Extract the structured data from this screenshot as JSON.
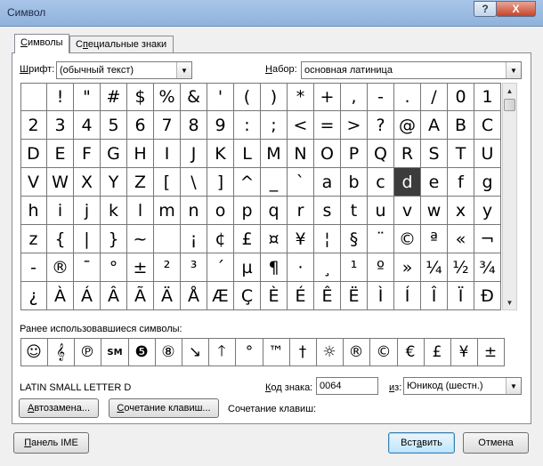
{
  "window": {
    "title": "Символ",
    "help_label": "?",
    "close_label": "X"
  },
  "tabs": [
    {
      "label": "Символы",
      "hotkey": "С",
      "rest": "имволы"
    },
    {
      "label": "Специальные знаки",
      "hotkey": "п",
      "pre": "С",
      "rest": "ециальные знаки"
    }
  ],
  "font": {
    "label_hot": "Ш",
    "label_rest": "рифт:",
    "value": "(обычный текст)"
  },
  "subset": {
    "label_hot": "Н",
    "label_rest": "абор:",
    "value": "основная латиница"
  },
  "grid": {
    "selected_row": 3,
    "selected_col": 14,
    "rows": [
      [
        "",
        "!",
        "\"",
        "#",
        "$",
        "%",
        "&",
        "'",
        "(",
        ")",
        "*",
        "+",
        ",",
        "-",
        ".",
        "/",
        "0",
        "1"
      ],
      [
        "2",
        "3",
        "4",
        "5",
        "6",
        "7",
        "8",
        "9",
        ":",
        ";",
        "<",
        "=",
        ">",
        "?",
        "@",
        "A",
        "B",
        "C"
      ],
      [
        "D",
        "E",
        "F",
        "G",
        "H",
        "I",
        "J",
        "K",
        "L",
        "M",
        "N",
        "O",
        "P",
        "Q",
        "R",
        "S",
        "T",
        "U"
      ],
      [
        "V",
        "W",
        "X",
        "Y",
        "Z",
        "[",
        "\\",
        "]",
        "^",
        "_",
        "`",
        "a",
        "b",
        "c",
        "d",
        "e",
        "f",
        "g"
      ],
      [
        "h",
        "i",
        "j",
        "k",
        "l",
        "m",
        "n",
        "o",
        "p",
        "q",
        "r",
        "s",
        "t",
        "u",
        "v",
        "w",
        "x",
        "y"
      ],
      [
        "z",
        "{",
        "|",
        "}",
        "~",
        "",
        "¡",
        "¢",
        "£",
        "¤",
        "¥",
        "¦",
        "§",
        "¨",
        "©",
        "ª",
        "«",
        "¬"
      ],
      [
        "-",
        "®",
        "¯",
        "°",
        "±",
        "²",
        "³",
        "´",
        "µ",
        "¶",
        "·",
        "¸",
        "¹",
        "º",
        "»",
        "¼",
        "½",
        "¾"
      ],
      [
        "¿",
        "À",
        "Á",
        "Â",
        "Ã",
        "Ä",
        "Å",
        "Æ",
        "Ç",
        "È",
        "É",
        "Ê",
        "Ë",
        "Ì",
        "Í",
        "Î",
        "Ï",
        "Ð"
      ]
    ]
  },
  "recent": {
    "label_pre": "Ранее использовавшиеся символы:",
    "symbols": [
      "☺",
      "𝄞",
      "℗",
      "SM",
      "❺",
      "⑧",
      "↘",
      "🡑",
      "°",
      "™",
      "†",
      "☼",
      "®",
      "©",
      "€",
      "£",
      "¥",
      "±"
    ]
  },
  "char_name": "LATIN SMALL LETTER D",
  "code": {
    "label_hot": "К",
    "label_rest": "од знака:",
    "value": "0064"
  },
  "from": {
    "label_hot": "и",
    "label_rest": "з:",
    "value": "Юникод (шестн.)"
  },
  "buttons": {
    "autocorrect": {
      "hot": "А",
      "rest": "втозамена..."
    },
    "shortcut_key": {
      "hot": "С",
      "rest": "очетание клавиш..."
    },
    "shortcut_label": "Сочетание клавиш:",
    "ime": {
      "hot": "П",
      "rest": "анель IME"
    },
    "insert": {
      "pre": "Вст",
      "hot": "а",
      "rest": "вить"
    },
    "cancel": "Отмена"
  }
}
